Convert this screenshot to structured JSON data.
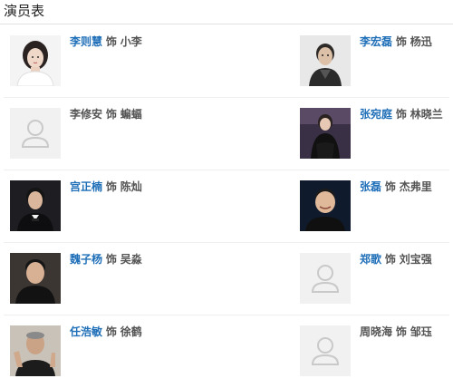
{
  "section": {
    "title": "演员表"
  },
  "cast": [
    {
      "actor": "李则慧",
      "role_word": "饰",
      "role": "小李",
      "actor_linked": true,
      "photo": "portrait-female-white-top"
    },
    {
      "actor": "李宏磊",
      "role_word": "饰",
      "role": "杨迅",
      "actor_linked": true,
      "photo": "portrait-male-dark-jacket"
    },
    {
      "actor": "李修安",
      "role_word": "饰",
      "role": "蝙蝠",
      "actor_linked": false,
      "photo": "placeholder-user-icon"
    },
    {
      "actor": "张宛庭",
      "role_word": "饰",
      "role": "林晓兰",
      "actor_linked": true,
      "photo": "portrait-female-black-dress"
    },
    {
      "actor": "宫正楠",
      "role_word": "饰",
      "role": "陈灿",
      "actor_linked": true,
      "photo": "portrait-male-suit-bowtie"
    },
    {
      "actor": "张磊",
      "role_word": "饰",
      "role": "杰弗里",
      "actor_linked": true,
      "photo": "portrait-male-dark-background"
    },
    {
      "actor": "魏子杨",
      "role_word": "饰",
      "role": "吴淼",
      "actor_linked": true,
      "photo": "portrait-male-black-shirt"
    },
    {
      "actor": "郑歌",
      "role_word": "饰",
      "role": "刘宝强",
      "actor_linked": true,
      "photo": "placeholder-user-icon"
    },
    {
      "actor": "任浩敏",
      "role_word": "饰",
      "role": "徐鹤",
      "actor_linked": true,
      "photo": "portrait-male-peace-sign"
    },
    {
      "actor": "周晓海",
      "role_word": "饰",
      "role": "邹珏",
      "actor_linked": false,
      "photo": "placeholder-user-icon"
    }
  ]
}
